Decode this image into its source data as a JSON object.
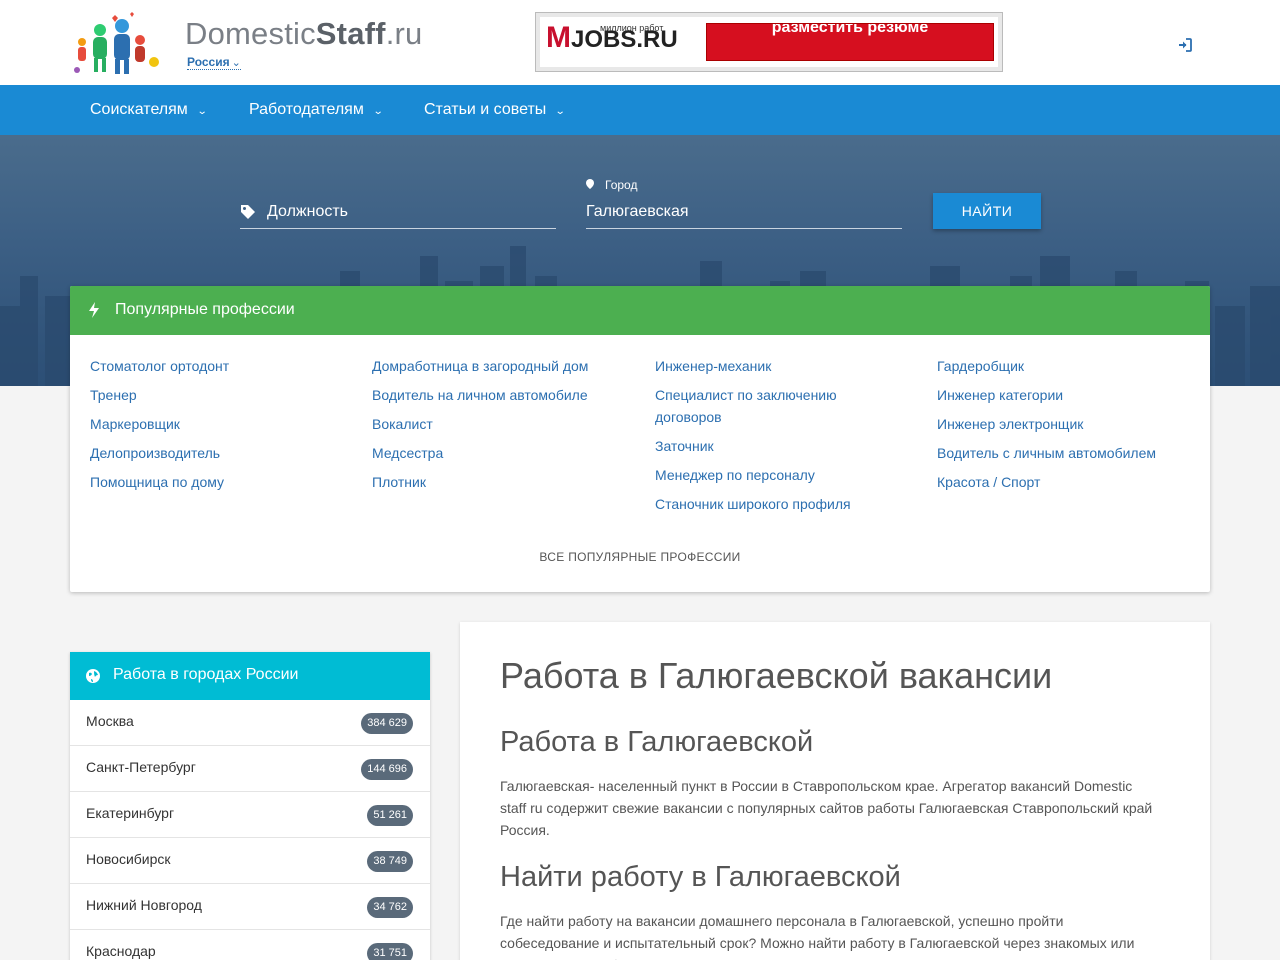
{
  "header": {
    "logo_light": "Domestic",
    "logo_bold": "Staff",
    "logo_suffix": ".ru",
    "region": "Россия",
    "banner": {
      "logo_m": "M",
      "logo_rest": "JOBS.RU",
      "tagline": "миллион работ",
      "cta": "разместить резюме"
    }
  },
  "nav": [
    {
      "label": "Соискателям"
    },
    {
      "label": "Работодателям"
    },
    {
      "label": "Статьи и советы"
    }
  ],
  "search": {
    "position_value": "Должность",
    "city_label": "Город",
    "city_value": "Галюгаевская",
    "find_label": "НАЙТИ"
  },
  "popular": {
    "title": "Популярные профессии",
    "columns": [
      [
        "Стоматолог ортодонт",
        "Тренер",
        "Маркеровщик",
        "Делопроизводитель",
        "Помощница по дому"
      ],
      [
        "Домработница в загородный дом",
        "Водитель на личном автомобиле",
        "Вокалист",
        "Медсестра",
        "Плотник"
      ],
      [
        "Инженер-механик",
        "Специалист по заключению договоров",
        "Заточник",
        "Менеджер по персоналу",
        "Станочник широкого профиля"
      ],
      [
        "Гардеробщик",
        "Инженер категории",
        "Инженер электронщик",
        "Водитель с личным автомобилем",
        "Красота / Спорт"
      ]
    ],
    "all_link": "ВСЕ ПОПУЛЯРНЫЕ ПРОФЕССИИ"
  },
  "cities": {
    "title": "Работа в городах России",
    "items": [
      {
        "name": "Москва",
        "count": "384 629"
      },
      {
        "name": "Санкт-Петербург",
        "count": "144 696"
      },
      {
        "name": "Екатеринбург",
        "count": "51 261"
      },
      {
        "name": "Новосибирск",
        "count": "38 749"
      },
      {
        "name": "Нижний Новгород",
        "count": "34 762"
      },
      {
        "name": "Краснодар",
        "count": "31 751"
      }
    ]
  },
  "article": {
    "h1": "Работа в Галюгаевской вакансии",
    "h2_1": "Работа в Галюгаевской",
    "p1": "Галюгаевская- населенный пункт в России в Ставропольском крае. Агрегатор вакансий Domestic staff ru содержит свежие вакансии с популярных сайтов работы Галюгаевская Ставропольский край Россия.",
    "h2_2": "Найти работу в Галюгаевской",
    "p2": "Где найти работу на вакансии домашнего персонала в Галюгаевской, успешно пройти собеседование и испытательный срок? Можно найти работу в Галюгаевской через знакомых или агентство по подбору персонала, но лучше всего искать самостоятельно."
  },
  "colors": {
    "nav": "#1a8ad4",
    "popular_header": "#4caf50",
    "cities_header": "#00bcd4",
    "link": "#2c6fb0"
  }
}
